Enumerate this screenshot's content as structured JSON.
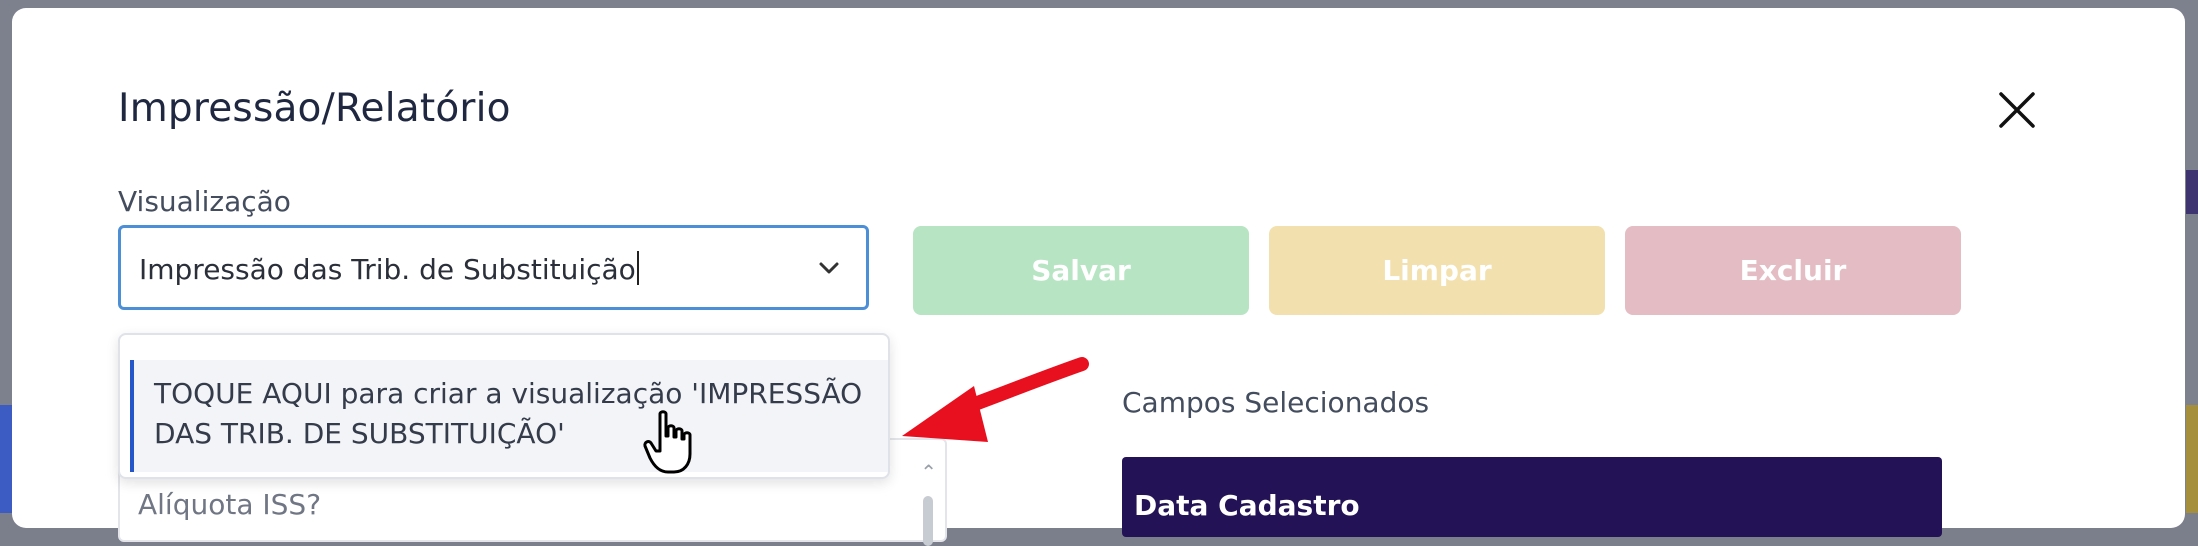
{
  "modal": {
    "title": "Impressão/Relatório",
    "close_label": "X"
  },
  "visualization": {
    "label": "Visualização",
    "value": "Impressão das Trib. de Substituição"
  },
  "toolbar": {
    "save_label": "Salvar",
    "clear_label": "Limpar",
    "delete_label": "Excluir"
  },
  "dropdown": {
    "option_text": "TOQUE AQUI para criar a visualização 'IMPRESSÃO DAS TRIB. DE SUBSTITUIÇÃO'"
  },
  "available_fields": {
    "items": [
      "Alíquota ISS?"
    ]
  },
  "selected_fields": {
    "label": "Campos Selecionados",
    "items": [
      "Data Cadastro"
    ]
  },
  "icons": {
    "close": "close-icon",
    "chevron": "chevron-down-icon",
    "cursor": "hand-pointer-icon",
    "annotation": "red-arrow-icon"
  },
  "colors": {
    "save": "#b7e4c3",
    "clear": "#f2e0ae",
    "delete": "#e3bdc3",
    "selected_bg": "#241256",
    "focus_border": "#4d8fd6",
    "annotation_red": "#e8101f"
  }
}
